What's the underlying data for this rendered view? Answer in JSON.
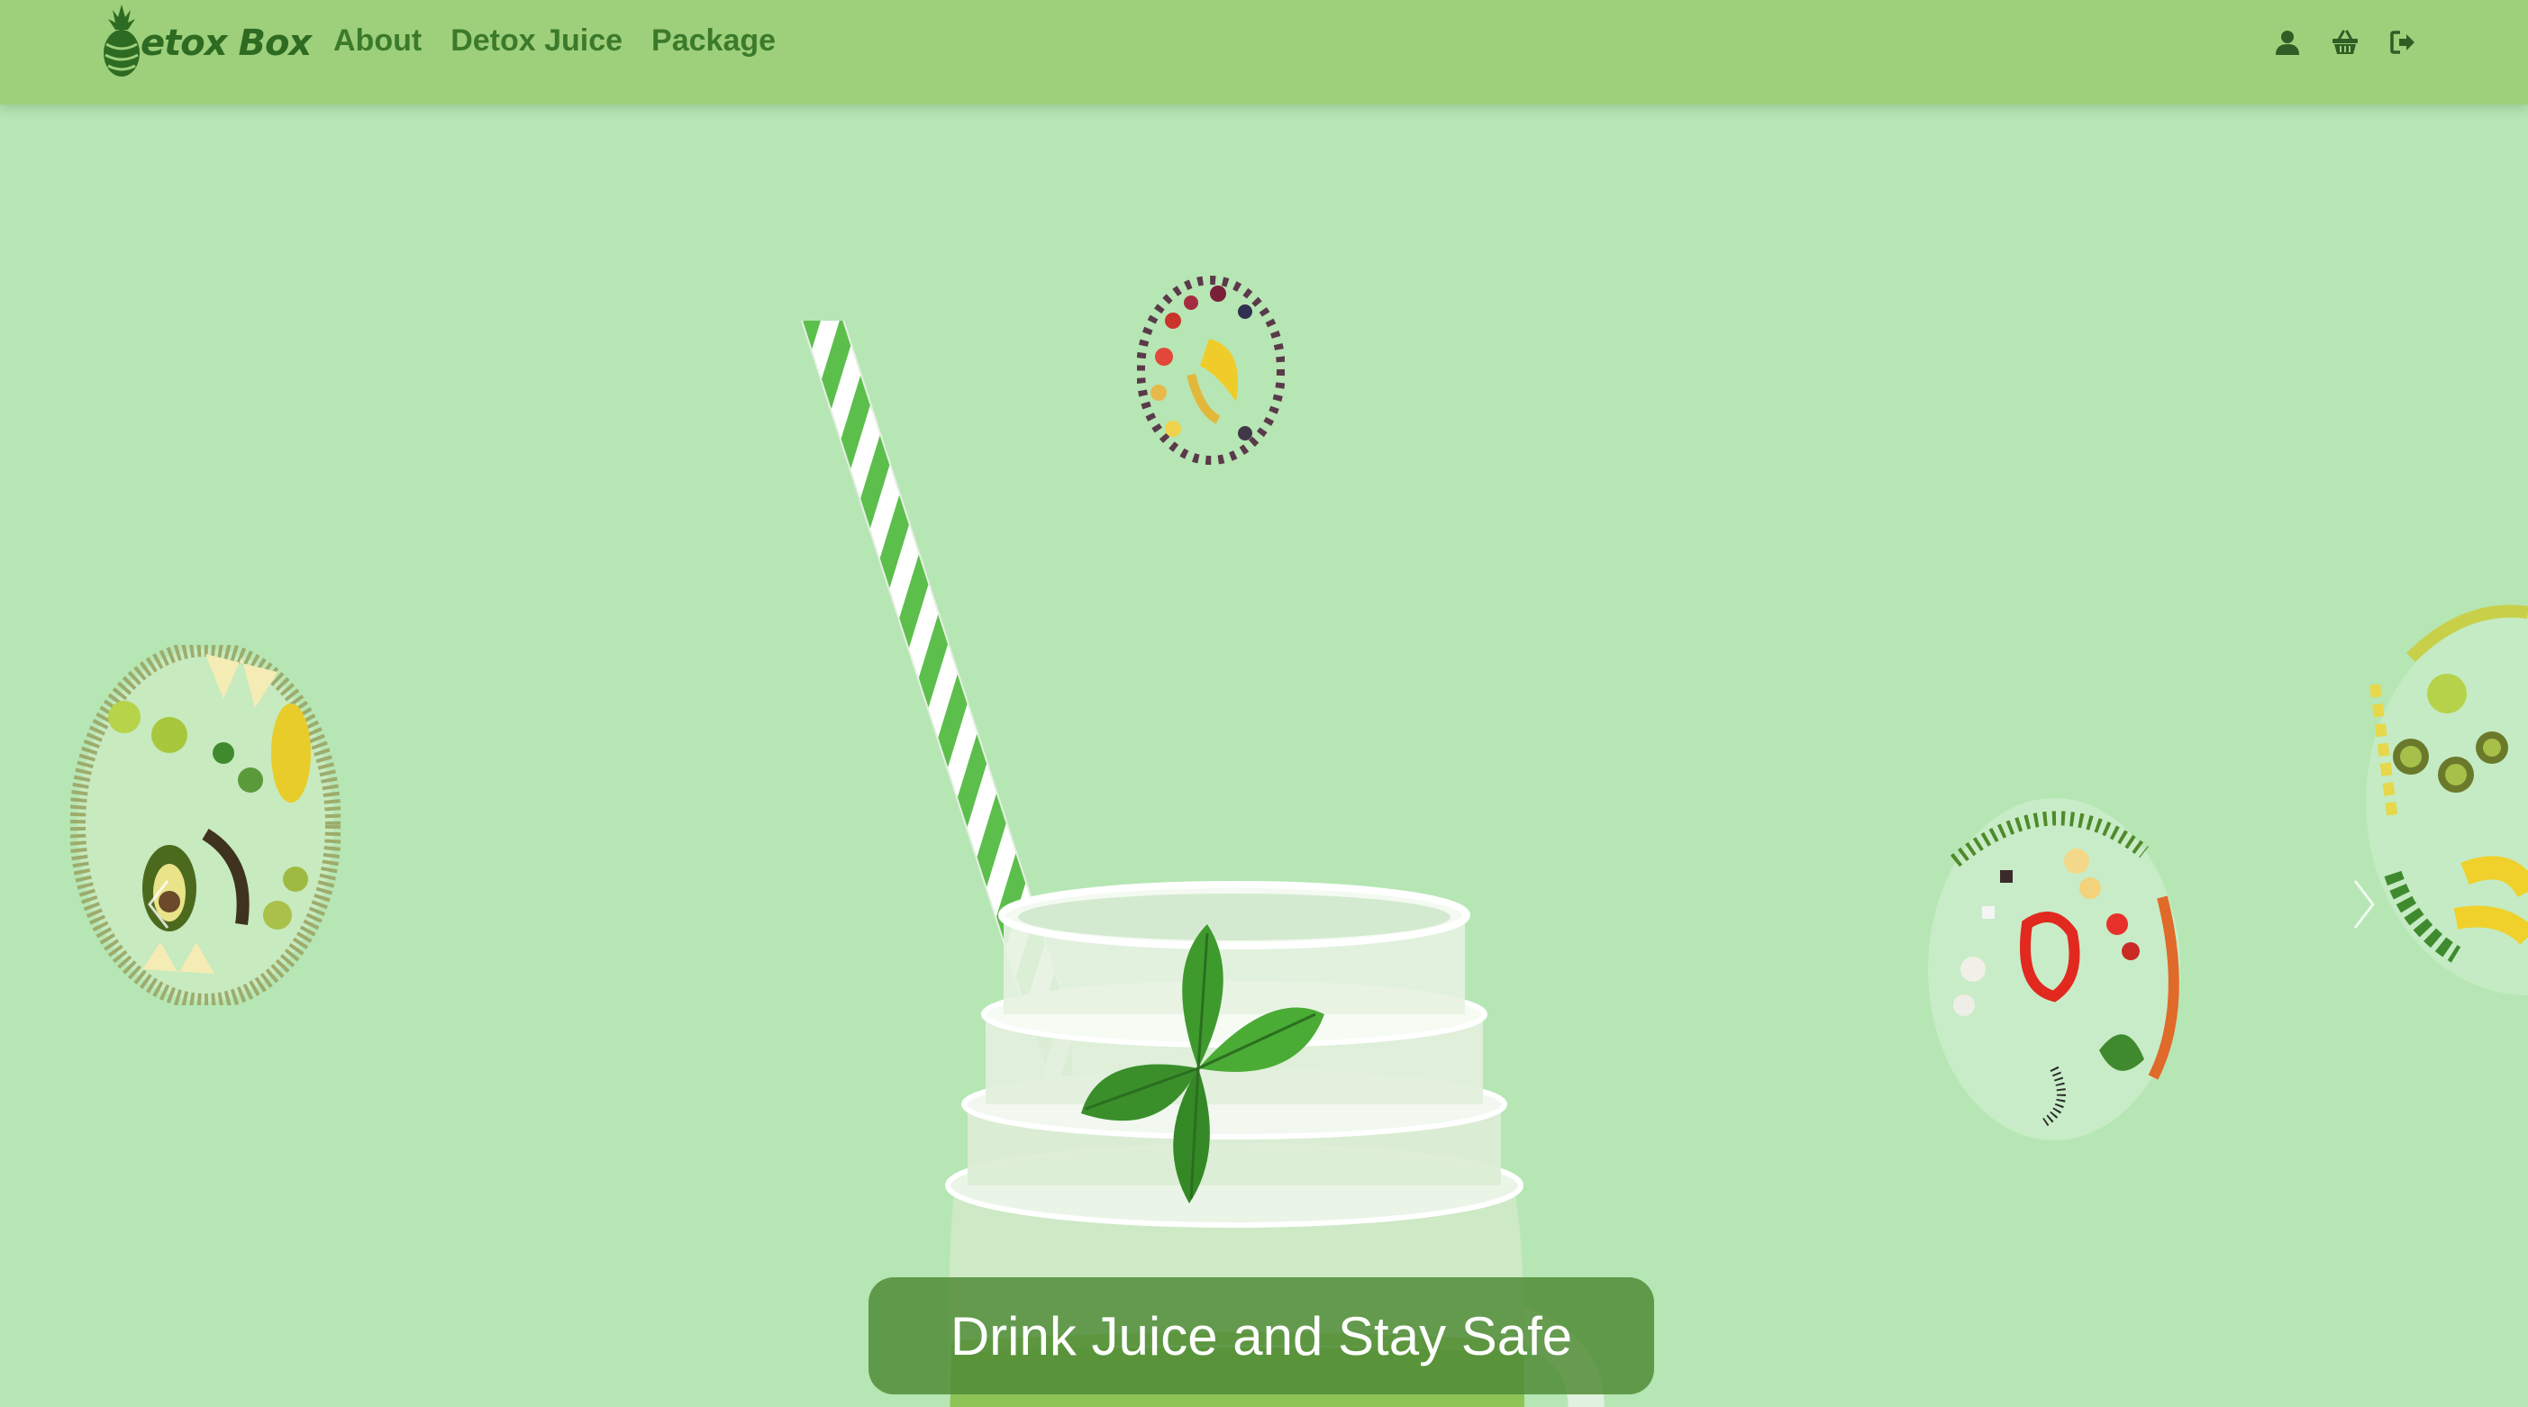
{
  "brand": {
    "name": "etox Box",
    "logo_icon": "pineapple-icon"
  },
  "nav": {
    "links": [
      {
        "label": "About"
      },
      {
        "label": "Detox Juice"
      },
      {
        "label": "Package"
      }
    ],
    "icons": [
      "user-icon",
      "basket-icon",
      "sign-out-icon"
    ]
  },
  "hero": {
    "caption": "Drink Juice and Stay Safe",
    "slides_visible": 4
  },
  "colors": {
    "navbar": "#9ed07b",
    "background": "#b6e6b4",
    "nav_text": "#3c7a2b",
    "caption_bg": "#5a9a3c"
  }
}
